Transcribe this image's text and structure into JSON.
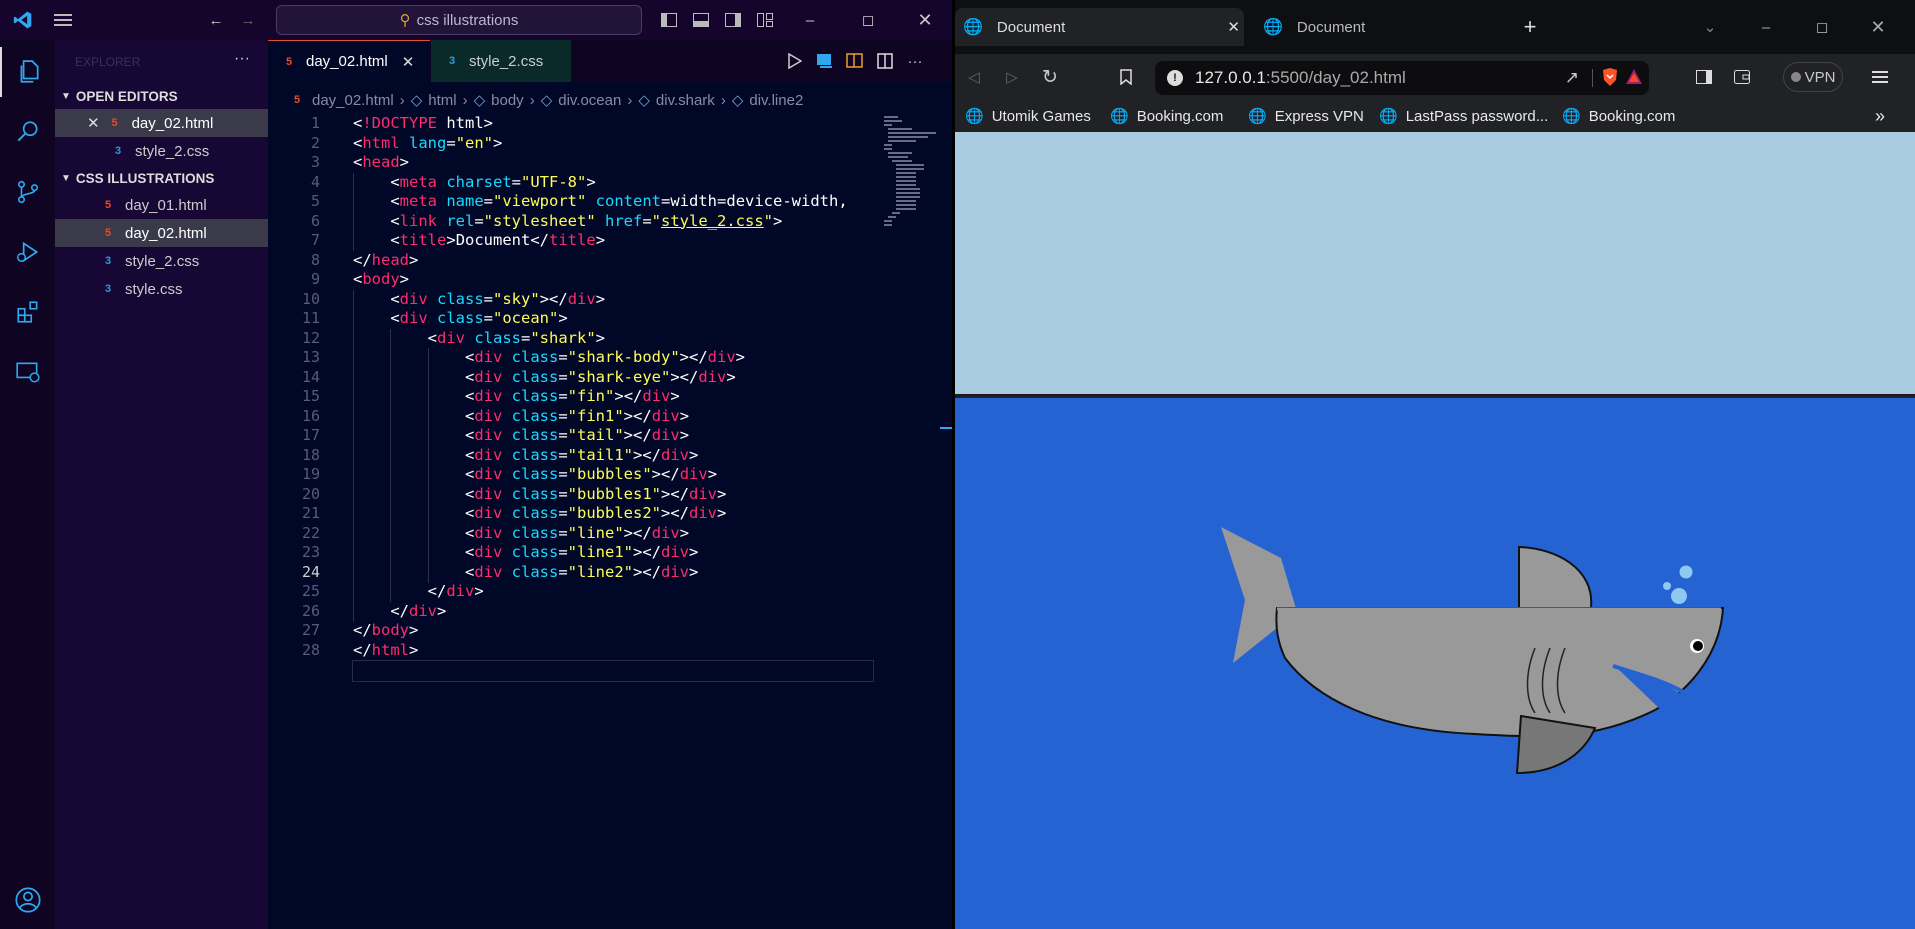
{
  "vscode": {
    "search": "css illustrations",
    "explorer_title": "EXPLORER",
    "open_editors": "OPEN EDITORS",
    "open_files": [
      {
        "name": "day_02.html",
        "type": "html"
      },
      {
        "name": "style_2.css",
        "type": "css"
      }
    ],
    "project": "CSS ILLUSTRATIONS",
    "project_files": [
      {
        "name": "day_01.html",
        "type": "html"
      },
      {
        "name": "day_02.html",
        "type": "html"
      },
      {
        "name": "style_2.css",
        "type": "css"
      },
      {
        "name": "style.css",
        "type": "css"
      }
    ],
    "tabs": [
      {
        "label": "day_02.html",
        "type": "html",
        "active": true
      },
      {
        "label": "style_2.css",
        "type": "css",
        "active": false
      }
    ],
    "breadcrumb": [
      "day_02.html",
      "html",
      "body",
      "div.ocean",
      "div.shark",
      "div.line2"
    ],
    "current_line": 24,
    "code": [
      "<!DOCTYPE html>",
      "<html lang=\"en\">",
      "<head>",
      "    <meta charset=\"UTF-8\">",
      "    <meta name=\"viewport\" content=\"width=device-width,",
      "    <link rel=\"stylesheet\" href=\"style_2.css\">",
      "    <title>Document</title>",
      "</head>",
      "<body>",
      "    <div class=\"sky\"></div>",
      "    <div class=\"ocean\">",
      "        <div class=\"shark\">",
      "            <div class=\"shark-body\"></div>",
      "            <div class=\"shark-eye\"></div>",
      "            <div class=\"fin\"></div>",
      "            <div class=\"fin1\"></div>",
      "            <div class=\"tail\"></div>",
      "            <div class=\"tail1\"></div>",
      "            <div class=\"bubbles\"></div>",
      "            <div class=\"bubbles1\"></div>",
      "            <div class=\"bubbles2\"></div>",
      "            <div class=\"line\"></div>",
      "            <div class=\"line1\"></div>",
      "            <div class=\"line2\"></div>",
      "        </div>",
      "    </div>",
      "</body>",
      "</html>"
    ]
  },
  "browser": {
    "tabs": [
      {
        "label": "Document",
        "active": true
      },
      {
        "label": "Document",
        "active": false
      }
    ],
    "url_host": "127.0.0.1",
    "url_path": ":5500/day_02.html",
    "vpn": "VPN",
    "bookmarks": [
      "Utomik Games",
      "Booking.com",
      "Express VPN",
      "LastPass password...",
      "Booking.com"
    ],
    "more": "»"
  },
  "colors": {
    "editor_bg": "#010727",
    "sky": "#a8cbe2",
    "ocean": "#2563d3",
    "shark": "#999999",
    "bubbles": "#8ec9f2"
  }
}
